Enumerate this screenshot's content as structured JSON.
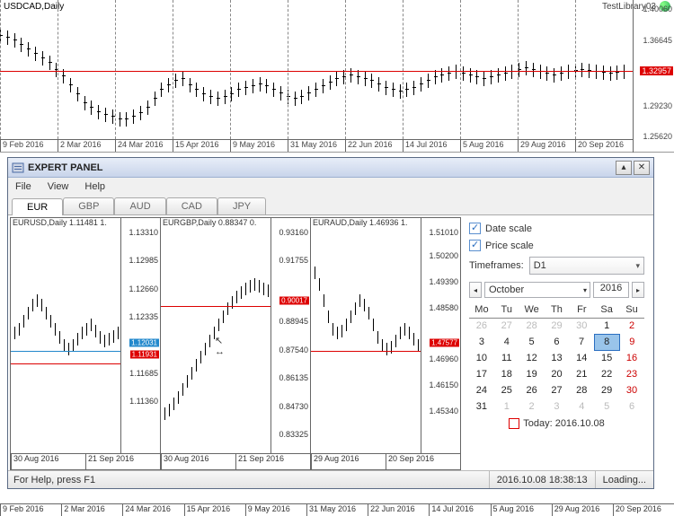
{
  "main_chart": {
    "title": "USDCAD,Daily",
    "indicator": "TestLibrary03",
    "y_ticks": [
      "1.40060",
      "1.36645",
      "1.29230",
      "1.25620"
    ],
    "price_line": "1.32957",
    "x_ticks": [
      "9 Feb 2016",
      "2 Mar 2016",
      "24 Mar 2016",
      "15 Apr 2016",
      "9 May 2016",
      "31 May 2016",
      "22 Jun 2016",
      "14 Jul 2016",
      "5 Aug 2016",
      "29 Aug 2016",
      "20 Sep 2016"
    ]
  },
  "panel": {
    "title": "EXPERT PANEL",
    "menu": [
      "File",
      "View",
      "Help"
    ],
    "tabs": [
      "EUR",
      "GBP",
      "AUD",
      "CAD",
      "JPY"
    ],
    "active_tab": 0
  },
  "mini_charts": [
    {
      "title": "EURUSD,Daily   1.11481 1.",
      "y_ticks": [
        {
          "v": "1.13310",
          "p": 6
        },
        {
          "v": "1.12985",
          "p": 18
        },
        {
          "v": "1.12660",
          "p": 30
        },
        {
          "v": "1.12335",
          "p": 42
        },
        {
          "v": "1.11685",
          "p": 66
        },
        {
          "v": "1.11360",
          "p": 78
        }
      ],
      "blue_tag": {
        "v": "1.12031",
        "p": 53
      },
      "red_tag": {
        "v": "1.11931",
        "p": 58
      },
      "x_ticks": [
        "30 Aug 2016",
        "21 Sep 2016"
      ]
    },
    {
      "title": "EURGBP,Daily   0.88347 0.",
      "y_ticks": [
        {
          "v": "0.93160",
          "p": 6
        },
        {
          "v": "0.91755",
          "p": 18
        },
        {
          "v": "0.88945",
          "p": 44
        },
        {
          "v": "0.87540",
          "p": 56
        },
        {
          "v": "0.86135",
          "p": 68
        },
        {
          "v": "0.84730",
          "p": 80
        },
        {
          "v": "0.83325",
          "p": 92
        }
      ],
      "red_tag": {
        "v": "0.90017",
        "p": 35
      },
      "x_ticks": [
        "30 Aug 2016",
        "21 Sep 2016"
      ]
    },
    {
      "title": "EURAUD,Daily   1.46936 1.",
      "y_ticks": [
        {
          "v": "1.51010",
          "p": 6
        },
        {
          "v": "1.50200",
          "p": 16
        },
        {
          "v": "1.49390",
          "p": 27
        },
        {
          "v": "1.48580",
          "p": 38
        },
        {
          "v": "1.46960",
          "p": 60
        },
        {
          "v": "1.46150",
          "p": 71
        },
        {
          "v": "1.45340",
          "p": 82
        }
      ],
      "red_tag": {
        "v": "1.47577",
        "p": 53
      },
      "x_ticks": [
        "29 Aug 2016",
        "20 Sep 2016"
      ]
    }
  ],
  "controls": {
    "date_scale": "Date scale",
    "price_scale": "Price scale",
    "timeframes_label": "Timeframes:",
    "timeframe": "D1",
    "month": "October",
    "year": "2016",
    "weekdays": [
      "Mo",
      "Tu",
      "We",
      "Th",
      "Fr",
      "Sa",
      "Su"
    ],
    "weeks": [
      [
        {
          "d": "26",
          "dim": 1
        },
        {
          "d": "27",
          "dim": 1
        },
        {
          "d": "28",
          "dim": 1
        },
        {
          "d": "29",
          "dim": 1
        },
        {
          "d": "30",
          "dim": 1
        },
        {
          "d": "1"
        },
        {
          "d": "2",
          "sun": 1
        }
      ],
      [
        {
          "d": "3"
        },
        {
          "d": "4"
        },
        {
          "d": "5"
        },
        {
          "d": "6"
        },
        {
          "d": "7"
        },
        {
          "d": "8",
          "sel": 1
        },
        {
          "d": "9",
          "sun": 1
        }
      ],
      [
        {
          "d": "10"
        },
        {
          "d": "11"
        },
        {
          "d": "12"
        },
        {
          "d": "13"
        },
        {
          "d": "14"
        },
        {
          "d": "15"
        },
        {
          "d": "16",
          "sun": 1
        }
      ],
      [
        {
          "d": "17"
        },
        {
          "d": "18"
        },
        {
          "d": "19"
        },
        {
          "d": "20"
        },
        {
          "d": "21"
        },
        {
          "d": "22"
        },
        {
          "d": "23",
          "sun": 1
        }
      ],
      [
        {
          "d": "24"
        },
        {
          "d": "25"
        },
        {
          "d": "26"
        },
        {
          "d": "27"
        },
        {
          "d": "28"
        },
        {
          "d": "29"
        },
        {
          "d": "30",
          "sun": 1
        }
      ],
      [
        {
          "d": "31"
        },
        {
          "d": "1",
          "dim": 1
        },
        {
          "d": "2",
          "dim": 1
        },
        {
          "d": "3",
          "dim": 1
        },
        {
          "d": "4",
          "dim": 1
        },
        {
          "d": "5",
          "dim": 1
        },
        {
          "d": "6",
          "dim": 1
        }
      ]
    ],
    "today": "Today: 2016.10.08"
  },
  "status": {
    "help": "For Help, press F1",
    "time": "2016.10.08 18:38:13",
    "loading": "Loading..."
  }
}
